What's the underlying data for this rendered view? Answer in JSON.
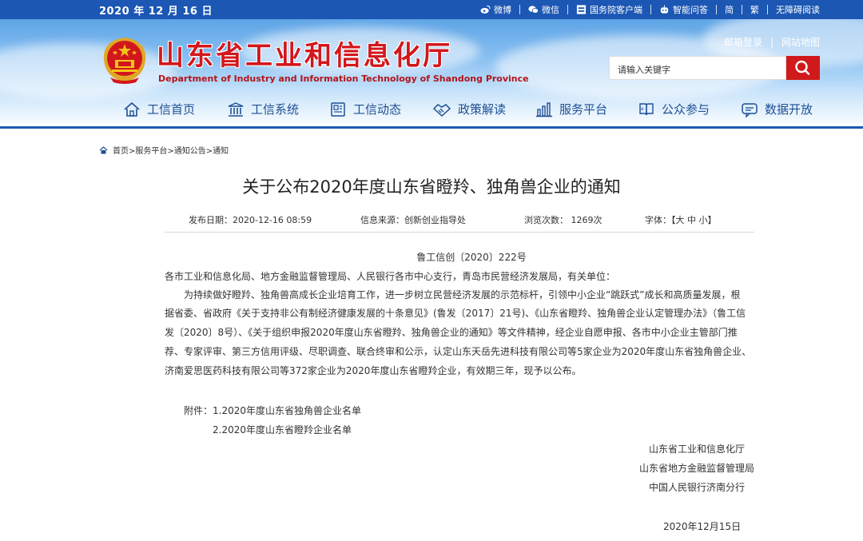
{
  "topbar": {
    "date": "2020 年 12 月 16 日",
    "links": [
      "微博",
      "微信",
      "国务院客户端",
      "智能问答",
      "简",
      "繁",
      "无障碍阅读"
    ]
  },
  "header": {
    "title": "山东省工业和信息化厅",
    "subtitle": "Department of Industry and Information Technology of Shandong Province",
    "links": [
      "邮箱登录",
      "网站地图"
    ],
    "search_placeholder": "请输入关键字"
  },
  "nav": [
    "工信首页",
    "工信系统",
    "工信动态",
    "政策解读",
    "服务平台",
    "公众参与",
    "数据开放"
  ],
  "colors": {
    "primary": "#1c57b4",
    "accent": "#d0191b"
  },
  "breadcrumb": "首页>服务平台>通知公告>通知",
  "article": {
    "title": "关于公布2020年度山东省瞪羚、独角兽企业的通知",
    "meta": {
      "date": "发布日期：2020-12-16 08:59",
      "source": "信息来源：创新创业指导处",
      "views": "浏览次数：  1269次",
      "font": "字体：【大 中 小】"
    },
    "doc_no": "鲁工信创〔2020〕222号",
    "salutation": "各市工业和信息化局、地方金融监督管理局、人民银行各市中心支行，青岛市民营经济发展局，有关单位：",
    "paragraph": [
      "为持续做好瞪羚、独角兽高成长企业培育工作，进一步树立民营经济发展的示范标杆，引领中小企业“跳跃式”成长和高质量发展，根",
      "据省委、省政府《关于支持非公有制经济健康发展的十条意见》(鲁发〔2017〕21号)、《山东省瞪羚、独角兽企业认定管理办法》（鲁工信",
      "发〔2020〕8号）、《关于组织申报2020年度山东省瞪羚、独角兽企业的通知》等文件精神，经企业自愿申报、各市中小企业主管部门推",
      "荐、专家评审、第三方信用评级、尽职调查、联合终审和公示，认定山东天岳先进科技有限公司等5家企业为2020年度山东省独角兽企业、",
      "济南爱思医药科技有限公司等372家企业为2020年度山东省瞪羚企业，有效期三年，现予以公布。"
    ],
    "attachments": [
      "附件：1.2020年度山东省独角兽企业名单",
      "2.2020年度山东省瞪羚企业名单"
    ],
    "signatures": [
      "山东省工业和信息化厅",
      "山东省地方金融监督管理局",
      "中国人民银行济南分行"
    ],
    "sign_date": "2020年12月15日"
  }
}
